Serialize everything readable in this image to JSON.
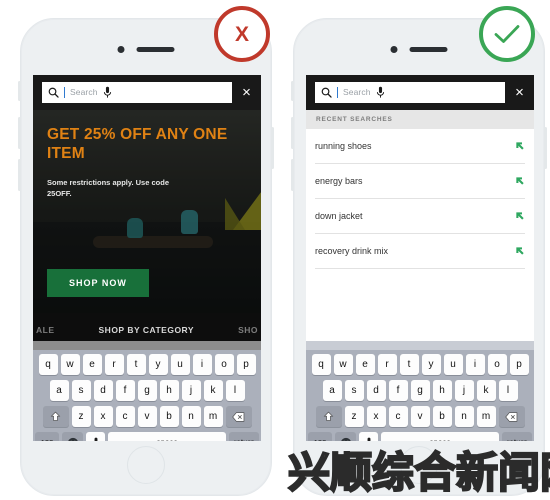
{
  "badges": {
    "bad": {
      "label": "X",
      "color": "#c0392b",
      "icon": "cross-icon"
    },
    "good": {
      "label": "",
      "color": "#3aa655",
      "icon": "check-icon"
    }
  },
  "search": {
    "placeholder": "Search",
    "value": "",
    "mic_icon": "microphone-icon",
    "search_icon": "magnifier-icon",
    "close_label": "×"
  },
  "left_phone": {
    "promo": {
      "headline": "GET 25% OFF ANY ONE ITEM",
      "subtext": "Some restrictions apply. Use code 25OFF.",
      "cta_label": "SHOP NOW",
      "headline_color": "#e08214",
      "cta_color": "#18703a"
    },
    "catnav": {
      "left_partial": "ALE",
      "center": "SHOP BY CATEGORY",
      "right_partial": "SHO"
    }
  },
  "right_phone": {
    "recent_header": "RECENT SEARCHES",
    "recent_items": [
      {
        "label": "running shoes",
        "icon": "arrow-up-left-icon"
      },
      {
        "label": "energy bars",
        "icon": "arrow-up-left-icon"
      },
      {
        "label": "down jacket",
        "icon": "arrow-up-left-icon"
      },
      {
        "label": "recovery drink mix",
        "icon": "arrow-up-left-icon"
      }
    ],
    "arrow_color": "#2fa860"
  },
  "keyboard": {
    "row1": [
      "q",
      "w",
      "e",
      "r",
      "t",
      "y",
      "u",
      "i",
      "o",
      "p"
    ],
    "row2": [
      "a",
      "s",
      "d",
      "f",
      "g",
      "h",
      "j",
      "k",
      "l"
    ],
    "row3": [
      "z",
      "x",
      "c",
      "v",
      "b",
      "n",
      "m"
    ],
    "shift_icon": "shift-arrow-icon",
    "backspace_icon": "backspace-icon",
    "numbers_label": "123",
    "emoji_icon": "smiley-face-icon",
    "mic_icon": "microphone-icon",
    "space_label": "space",
    "return_label": "return"
  },
  "watermark": {
    "text": "兴顺综合新闻网"
  }
}
